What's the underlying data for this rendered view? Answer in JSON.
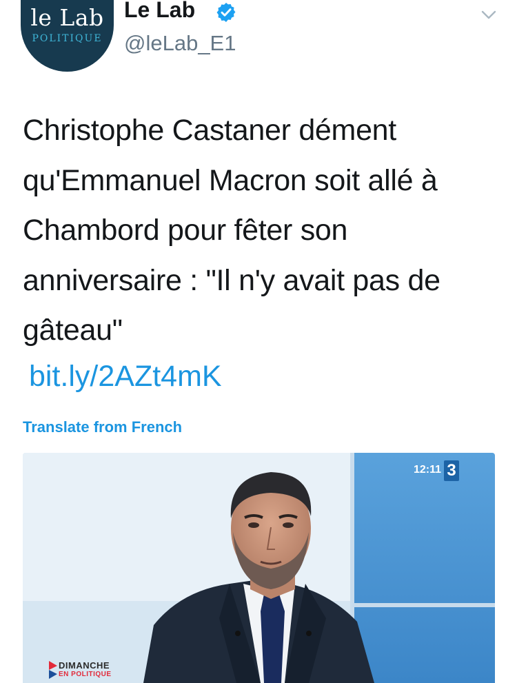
{
  "header": {
    "avatar_line1": "le Lab",
    "avatar_line2": "POLITIQUE",
    "display_name": "Le Lab",
    "handle": "@leLab_E1",
    "verified_icon": "verified-badge-icon",
    "menu_icon": "chevron-down-icon"
  },
  "tweet": {
    "text_lines": [
      "Christophe Castaner dément",
      "qu'Emmanuel Macron soit allé à",
      "Chambord pour fêter son",
      "anniversaire : \"Il n'y avait pas de",
      "gâteau\""
    ],
    "link": "bit.ly/2AZt4mK",
    "translate_label": "Translate from French"
  },
  "media": {
    "clock": "12:11",
    "channel_logo": "3",
    "show_line1": "DIMANCHE",
    "show_line2": "EN POLITIQUE"
  },
  "colors": {
    "link": "#1b95e0",
    "avatar_bg": "#173a4f",
    "handle": "#657786"
  }
}
